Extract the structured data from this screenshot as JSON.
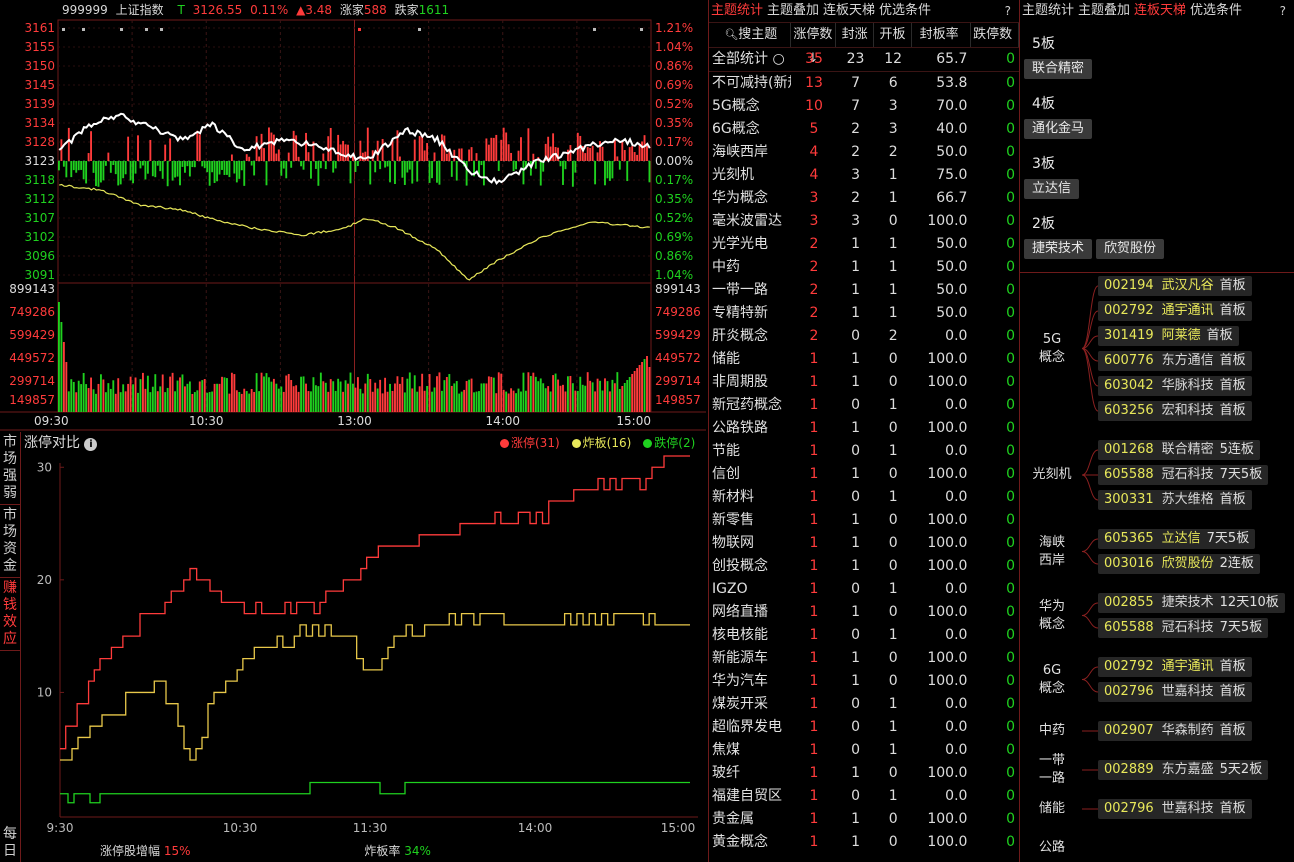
{
  "header": {
    "code": "999999",
    "name": "上证指数",
    "flag": "T",
    "price": "3126.55",
    "pct": "0.11%",
    "chg": "▲3.48",
    "up_label": "涨家",
    "up_count": "588",
    "down_label": "跌家",
    "down_count": "1611"
  },
  "price_axis_left": [
    "3161",
    "3155",
    "3150",
    "3145",
    "3139",
    "3134",
    "3128",
    "3123",
    "3118",
    "3112",
    "3107",
    "3102",
    "3096",
    "3091"
  ],
  "price_axis_right": [
    "1.21%",
    "1.04%",
    "0.86%",
    "0.69%",
    "0.52%",
    "0.35%",
    "0.17%",
    "0.00%",
    "0.17%",
    "0.35%",
    "0.52%",
    "0.69%",
    "0.86%",
    "1.04%"
  ],
  "vol_axis": [
    "899143",
    "749286",
    "599429",
    "449572",
    "299714",
    "149857"
  ],
  "time_axis": [
    "09:30",
    "10:30",
    "13:00",
    "14:00",
    "15:00"
  ],
  "colors": {
    "up": "#ff3b3b",
    "down": "#1fd11f",
    "index": "#ffffff",
    "avg": "#e8e85a",
    "frame": "#6e1a1a"
  },
  "side_tabs": [
    "市场强弱",
    "市场资金",
    "赚钱效应",
    "每日"
  ],
  "active_side_tab": 2,
  "compare": {
    "title": "涨停对比",
    "info_icon": "info-icon",
    "legend": [
      {
        "label": "涨停(31)",
        "color": "#ff3b3b"
      },
      {
        "label": "炸板(16)",
        "color": "#e8e85a"
      },
      {
        "label": "跌停(2)",
        "color": "#1fd11f"
      }
    ],
    "y_ticks": [
      "30",
      "20",
      "10"
    ],
    "x_ticks": [
      "9:30",
      "10:30",
      "11:30",
      "14:00",
      "15:00"
    ],
    "footer": {
      "label1": "涨停股增幅",
      "value1": "15%",
      "label2": "炸板率",
      "value2": "34%"
    }
  },
  "chart_data": {
    "type": "line",
    "x": [
      "9:30",
      "10:30",
      "11:30",
      "14:00",
      "15:00"
    ],
    "ylim": [
      0,
      31
    ],
    "series": [
      {
        "name": "涨停(31)",
        "values": [
          5,
          18,
          21,
          26,
          31
        ]
      },
      {
        "name": "炸板(16)",
        "values": [
          3,
          12,
          15,
          17,
          16
        ]
      },
      {
        "name": "跌停(2)",
        "values": [
          1,
          1,
          2,
          2,
          2
        ]
      }
    ]
  },
  "mid_tabs": [
    "主题统计",
    "主题叠加",
    "连板天梯",
    "优选条件"
  ],
  "mid_active": 0,
  "help": "?",
  "table_head": [
    "搜主题",
    "涨停数↓",
    "封涨",
    "开板",
    "封板率",
    "跌停数"
  ],
  "table": [
    [
      "全部统计 ○",
      "35",
      "23",
      "12",
      "65.7",
      "0"
    ],
    [
      "不可减持(新规)",
      "13",
      "7",
      "6",
      "53.8",
      "0"
    ],
    [
      "5G概念",
      "10",
      "7",
      "3",
      "70.0",
      "0"
    ],
    [
      "6G概念",
      "5",
      "2",
      "3",
      "40.0",
      "0"
    ],
    [
      "海峡西岸",
      "4",
      "2",
      "2",
      "50.0",
      "0"
    ],
    [
      "光刻机",
      "4",
      "3",
      "1",
      "75.0",
      "0"
    ],
    [
      "华为概念",
      "3",
      "2",
      "1",
      "66.7",
      "0"
    ],
    [
      "毫米波雷达",
      "3",
      "3",
      "0",
      "100.0",
      "0"
    ],
    [
      "光学光电",
      "2",
      "1",
      "1",
      "50.0",
      "0"
    ],
    [
      "中药",
      "2",
      "1",
      "1",
      "50.0",
      "0"
    ],
    [
      "一带一路",
      "2",
      "1",
      "1",
      "50.0",
      "0"
    ],
    [
      "专精特新",
      "2",
      "1",
      "1",
      "50.0",
      "0"
    ],
    [
      "肝炎概念",
      "2",
      "0",
      "2",
      "0.0",
      "0"
    ],
    [
      "储能",
      "1",
      "1",
      "0",
      "100.0",
      "0"
    ],
    [
      "非周期股",
      "1",
      "1",
      "0",
      "100.0",
      "0"
    ],
    [
      "新冠药概念",
      "1",
      "0",
      "1",
      "0.0",
      "0"
    ],
    [
      "公路铁路",
      "1",
      "1",
      "0",
      "100.0",
      "0"
    ],
    [
      "节能",
      "1",
      "0",
      "1",
      "0.0",
      "0"
    ],
    [
      "信创",
      "1",
      "1",
      "0",
      "100.0",
      "0"
    ],
    [
      "新材料",
      "1",
      "0",
      "1",
      "0.0",
      "0"
    ],
    [
      "新零售",
      "1",
      "1",
      "0",
      "100.0",
      "0"
    ],
    [
      "物联网",
      "1",
      "1",
      "0",
      "100.0",
      "0"
    ],
    [
      "创投概念",
      "1",
      "1",
      "0",
      "100.0",
      "0"
    ],
    [
      "IGZO",
      "1",
      "0",
      "1",
      "0.0",
      "0"
    ],
    [
      "网络直播",
      "1",
      "1",
      "0",
      "100.0",
      "0"
    ],
    [
      "核电核能",
      "1",
      "0",
      "1",
      "0.0",
      "0"
    ],
    [
      "新能源车",
      "1",
      "1",
      "0",
      "100.0",
      "0"
    ],
    [
      "华为汽车",
      "1",
      "1",
      "0",
      "100.0",
      "0"
    ],
    [
      "煤炭开采",
      "1",
      "0",
      "1",
      "0.0",
      "0"
    ],
    [
      "超临界发电",
      "1",
      "0",
      "1",
      "0.0",
      "0"
    ],
    [
      "焦煤",
      "1",
      "0",
      "1",
      "0.0",
      "0"
    ],
    [
      "玻纤",
      "1",
      "1",
      "0",
      "100.0",
      "0"
    ],
    [
      "福建自贸区",
      "1",
      "0",
      "1",
      "0.0",
      "0"
    ],
    [
      "贵金属",
      "1",
      "1",
      "0",
      "100.0",
      "0"
    ],
    [
      "黄金概念",
      "1",
      "1",
      "0",
      "100.0",
      "0"
    ]
  ],
  "right_tabs": [
    "主题统计",
    "主题叠加",
    "连板天梯",
    "优选条件"
  ],
  "right_active": 2,
  "ladder": [
    {
      "level": "5板",
      "stocks": [
        "联合精密"
      ]
    },
    {
      "level": "4板",
      "stocks": [
        "通化金马"
      ]
    },
    {
      "level": "3板",
      "stocks": [
        "立达信"
      ]
    },
    {
      "level": "2板",
      "stocks": [
        "捷荣技术",
        "欣贺股份"
      ]
    }
  ],
  "groups": [
    {
      "name": "5G概念",
      "items": [
        [
          "002194",
          "武汉凡谷",
          "首板",
          1
        ],
        [
          "002792",
          "通宇通讯",
          "首板",
          1
        ],
        [
          "301419",
          "阿莱德",
          "首板",
          1
        ],
        [
          "600776",
          "东方通信",
          "首板",
          0
        ],
        [
          "603042",
          "华脉科技",
          "首板",
          0
        ],
        [
          "603256",
          "宏和科技",
          "首板",
          0
        ]
      ]
    },
    {
      "name": "光刻机",
      "items": [
        [
          "001268",
          "联合精密",
          "5连板",
          0
        ],
        [
          "605588",
          "冠石科技",
          "7天5板",
          0
        ],
        [
          "300331",
          "苏大维格",
          "首板",
          0
        ]
      ]
    },
    {
      "name": "海峡西岸",
      "items": [
        [
          "605365",
          "立达信",
          "7天5板",
          1
        ],
        [
          "003016",
          "欣贺股份",
          "2连板",
          1
        ]
      ]
    },
    {
      "name": "华为概念",
      "items": [
        [
          "002855",
          "捷荣技术",
          "12天10板",
          0
        ],
        [
          "605588",
          "冠石科技",
          "7天5板",
          0
        ]
      ]
    },
    {
      "name": "6G概念",
      "items": [
        [
          "002792",
          "通宇通讯",
          "首板",
          1
        ],
        [
          "002796",
          "世嘉科技",
          "首板",
          0
        ]
      ]
    },
    {
      "name": "中药",
      "items": [
        [
          "002907",
          "华森制药",
          "首板",
          0
        ]
      ]
    },
    {
      "name": "一带一路",
      "items": [
        [
          "002889",
          "东方嘉盛",
          "5天2板",
          0
        ]
      ]
    },
    {
      "name": "储能",
      "items": [
        [
          "002796",
          "世嘉科技",
          "首板",
          0
        ]
      ]
    },
    {
      "name": "公路",
      "items": []
    }
  ]
}
